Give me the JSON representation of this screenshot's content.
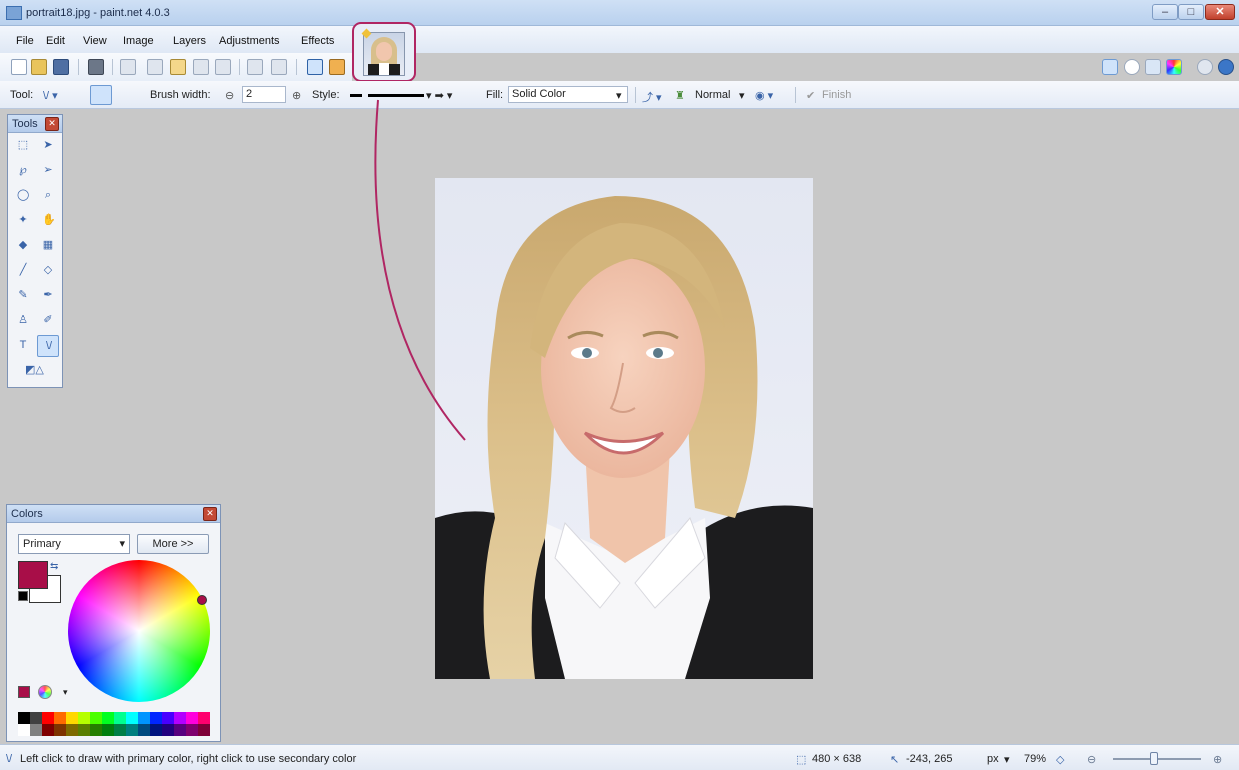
{
  "window": {
    "title": "portrait18.jpg - paint.net 4.0.3",
    "min_label": "–",
    "max_label": "□",
    "close_label": "✕"
  },
  "menu": {
    "items": [
      "File",
      "Edit",
      "View",
      "Image",
      "Layers",
      "Adjustments",
      "Effects"
    ]
  },
  "image_tabs": {
    "active": "portrait18.jpg"
  },
  "toolbar": {
    "tool_label": "Tool:",
    "brush_width_label": "Brush width:",
    "brush_width_value": "2",
    "style_label": "Style:",
    "fill_label": "Fill:",
    "fill_value": "Solid Color",
    "blend_mode": "Normal",
    "finish_label": "Finish"
  },
  "tools_panel": {
    "title": "Tools",
    "tools": [
      {
        "name": "rectangle-select-icon",
        "glyph": "⬚",
        "selected": false
      },
      {
        "name": "move-selected-pixels-icon",
        "glyph": "➤",
        "selected": false
      },
      {
        "name": "lasso-select-icon",
        "glyph": "℘",
        "selected": false
      },
      {
        "name": "move-selection-icon",
        "glyph": "➢",
        "selected": false
      },
      {
        "name": "ellipse-select-icon",
        "glyph": "◯",
        "selected": false
      },
      {
        "name": "zoom-icon",
        "glyph": "⌕",
        "selected": false
      },
      {
        "name": "magic-wand-icon",
        "glyph": "✦",
        "selected": false
      },
      {
        "name": "pan-icon",
        "glyph": "✋",
        "selected": false
      },
      {
        "name": "paint-bucket-icon",
        "glyph": "◆",
        "selected": false
      },
      {
        "name": "gradient-icon",
        "glyph": "▦",
        "selected": false
      },
      {
        "name": "paintbrush-icon",
        "glyph": "╱",
        "selected": false
      },
      {
        "name": "eraser-icon",
        "glyph": "◇",
        "selected": false
      },
      {
        "name": "pencil-icon",
        "glyph": "✎",
        "selected": false
      },
      {
        "name": "color-picker-icon",
        "glyph": "✒",
        "selected": false
      },
      {
        "name": "clone-stamp-icon",
        "glyph": "♙",
        "selected": false
      },
      {
        "name": "recolor-icon",
        "glyph": "✐",
        "selected": false
      },
      {
        "name": "text-icon",
        "glyph": "T",
        "selected": false
      },
      {
        "name": "line-curve-icon",
        "glyph": "\\/",
        "selected": true
      },
      {
        "name": "shapes-icon",
        "glyph": "◩△",
        "selected": false
      }
    ]
  },
  "colors_panel": {
    "title": "Colors",
    "mode": "Primary",
    "more_button": "More >>",
    "primary_color": "#a80e48",
    "secondary_color": "#ffffff",
    "palette": [
      "#000000",
      "#404040",
      "#ff0000",
      "#ff6a00",
      "#ffd800",
      "#b6ff00",
      "#4cff00",
      "#00ff21",
      "#00ff90",
      "#00ffff",
      "#0094ff",
      "#0026ff",
      "#4800ff",
      "#b200ff",
      "#ff00dc",
      "#ff006e",
      "#ffffff",
      "#808080",
      "#7f0000",
      "#7f3300",
      "#7f6a00",
      "#5b7f00",
      "#267f00",
      "#007f0e",
      "#007f46",
      "#007f7f",
      "#004a7f",
      "#00137f",
      "#21007f",
      "#57007f",
      "#7f006e",
      "#7f0037"
    ]
  },
  "statusbar": {
    "hint": "Left click to draw with primary color, right click to use secondary color",
    "image_size": "480 × 638",
    "cursor_pos": "-243, 265",
    "units": "px",
    "zoom": "79%"
  },
  "colors": {
    "accent": "#b02663",
    "titlebar": "#c4d8f1"
  }
}
